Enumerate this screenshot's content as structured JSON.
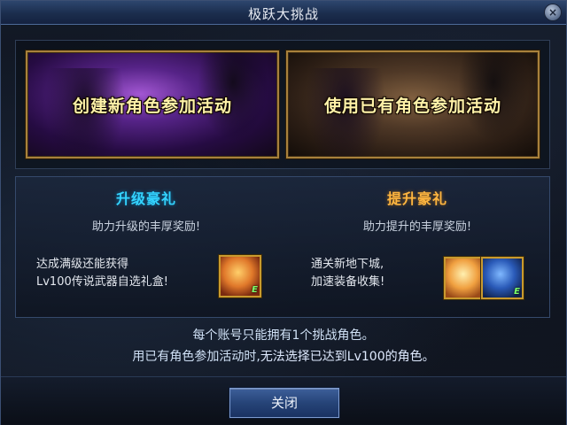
{
  "dialog": {
    "title": "极跃大挑战",
    "close_icon_glyph": "×"
  },
  "options": {
    "create_new": "创建新角色参加活动",
    "use_existing": "使用已有角色参加活动"
  },
  "rewards": {
    "left": {
      "title": "升级豪礼",
      "subtitle": "助力升级的丰厚奖励!",
      "desc_line1": "达成满级还能获得",
      "desc_line2": "Lv100传说武器自选礼盒!",
      "item_badge": "E",
      "title_color": "#34d4ff"
    },
    "right": {
      "title": "提升豪礼",
      "subtitle": "助力提升的丰厚奖励!",
      "desc_line1": "通关新地下城,",
      "desc_line2": "加速装备收集!",
      "item_badge": "E",
      "title_color": "#ffb640"
    }
  },
  "notice": {
    "line1": "每个账号只能拥有1个挑战角色。",
    "line2_prefix": "用已有角色参加活动时,",
    "line2_highlight": "无法选择已达到Lv100的角色。"
  },
  "footer": {
    "close_label": "关闭"
  },
  "colors": {
    "frame_border": "#3b4f73",
    "gold_border": "#a8813c",
    "highlight_text": "#d8e6ff"
  }
}
